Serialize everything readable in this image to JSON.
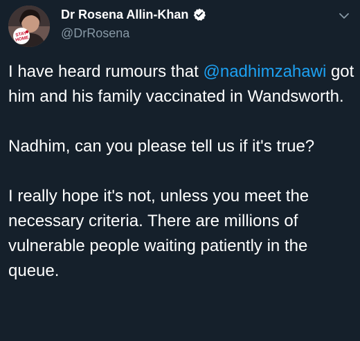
{
  "author": {
    "display_name": "Dr Rosena Allin-Khan",
    "handle": "@DrRosena",
    "verified": true,
    "avatar_badge_text": "STAY HOME"
  },
  "icons": {
    "verified": "verified-badge-icon",
    "menu": "chevron-down-icon"
  },
  "colors": {
    "background": "#15202b",
    "text": "#ffffff",
    "secondary": "#8899a6",
    "link": "#1da1f2"
  },
  "tweet": {
    "p1_before": "I have heard rumours that ",
    "p1_mention": "@nadhimzahawi",
    "p1_after": " got him and his family vaccinated in Wandsworth.",
    "p2": "Nadhim, can you please tell us if it's true?",
    "p3": "I really hope it's not, unless you meet the necessary criteria. There are millions of vulnerable people waiting patiently in the queue."
  }
}
